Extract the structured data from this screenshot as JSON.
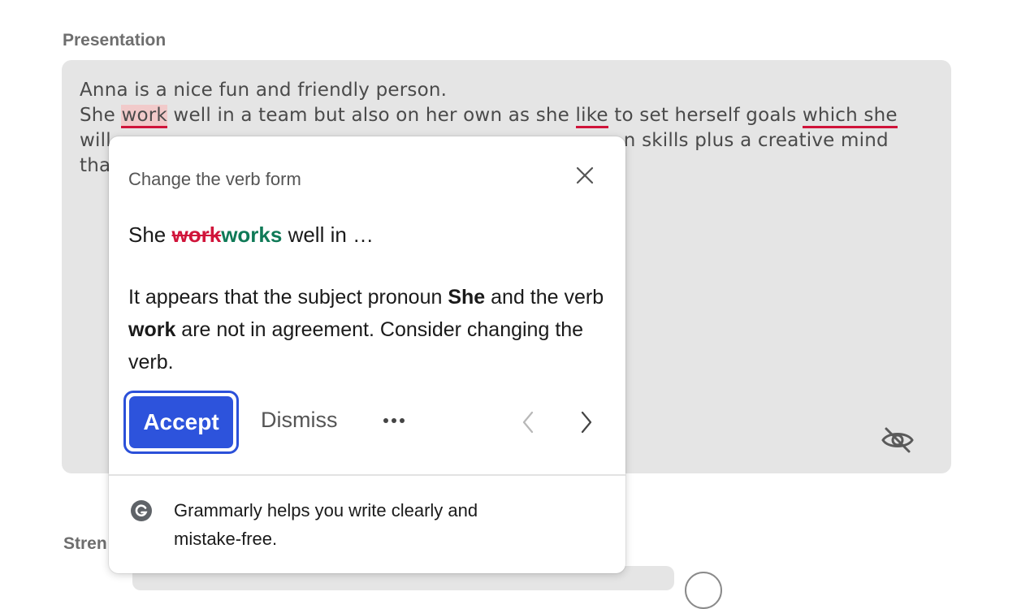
{
  "section_label": "Presentation",
  "textarea": {
    "line1": "Anna is a nice fun and friendly person.",
    "line2": {
      "seg1": "She ",
      "err1": "work",
      "seg2": " well in a team but also on her own as she ",
      "err2": "like",
      "seg3": " to set herself goals ",
      "err3": "which she"
    },
    "line3": {
      "start": "will",
      "end": "n skills plus a creative mind"
    },
    "line4": {
      "start": "tha"
    },
    "visibility_icon": "eye-off-icon"
  },
  "next_section_label": "Stren",
  "popup": {
    "title": "Change the verb form",
    "suggestion": {
      "prefix": "She ",
      "removed": "work",
      "added": "works",
      "suffix": " well in …"
    },
    "explanation": {
      "p1": "It appears that the subject pronoun ",
      "b1": "She",
      "p2": " and the verb ",
      "b2": "work",
      "p3": " are not in agreement. Consider changing the verb."
    },
    "accept_label": "Accept",
    "dismiss_label": "Dismiss",
    "more_icon": "more-horizontal-icon",
    "prev_icon": "chevron-left-icon",
    "next_icon": "chevron-right-icon",
    "footer_text": "Grammarly helps you write clearly and mistake-free.",
    "logo_icon": "grammarly-logo-icon"
  },
  "colors": {
    "error": "#d0143a",
    "insert": "#0f7a57",
    "accent": "#2d53dc",
    "textarea_bg": "#e5e5e5"
  }
}
